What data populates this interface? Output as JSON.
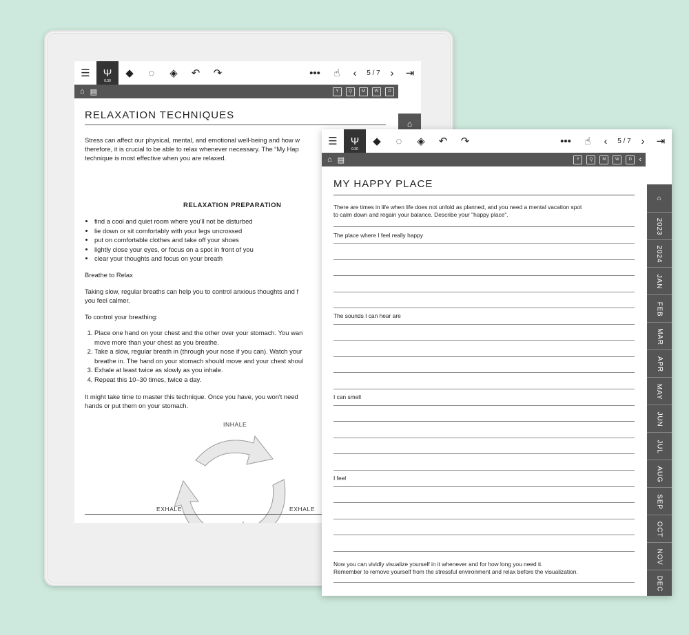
{
  "page1": {
    "toolbar": {
      "pen_size": "0.30",
      "page_indicator": "5 / 7"
    },
    "nav_boxes": [
      "Y",
      "Q",
      "M",
      "W",
      "D"
    ],
    "title": "RELAXATION TECHNIQUES",
    "intro_lines": [
      "Stress can affect our physical, mental, and emotional well-being and how w",
      "therefore, it is crucial to be able to relax whenever necessary. The “My Hap",
      "technique is most effective when you are relaxed."
    ],
    "prep_heading": "RELAXATION PREPARATION",
    "prep_items": [
      "find a cool and quiet room where you'll not be disturbed",
      "lie down or sit comfortably with your legs uncrossed",
      "put on comfortable clothes and take off your shoes",
      "lightly close your eyes, or focus on a spot in front of you",
      "clear your thoughts and focus on your breath"
    ],
    "breathe_heading": "Breathe to Relax",
    "breathe_lines": [
      "Taking slow, regular breaths can help you to control anxious thoughts and f",
      "you feel calmer."
    ],
    "control_heading": "To control your breathing:",
    "steps": [
      "Place one hand on your chest and the other over your stomach. You wan",
      "move more than your chest as you breathe.",
      "Take a slow, regular breath in (through your nose if you can). Watch your",
      "breathe in. The hand on your stomach should move and your chest shoul",
      "Exhale at least twice as slowly as you inhale.",
      "Repeat this 10–30 times, twice a day."
    ],
    "closing_lines": [
      "It might take time to master this technique. Once you have, you won't need",
      "hands or put them on your stomach."
    ],
    "cycle_labels": {
      "inhale": "INHALE",
      "exhale_left": "EXHALE",
      "exhale_right": "EXHALE"
    }
  },
  "page2": {
    "toolbar": {
      "pen_size": "0.30",
      "page_indicator": "5 / 7"
    },
    "nav_boxes": [
      "Y",
      "Q",
      "M",
      "W",
      "D"
    ],
    "title": "MY HAPPY PLACE",
    "intro_lines": [
      "There are times in life when life does not unfold as planned, and you need a mental vacation spot",
      "to calm down and regain your balance. Describe your \"happy place\"."
    ],
    "sections": [
      "The place where I feel really happy",
      "The sounds I can hear are",
      "I can smell",
      "I feel"
    ],
    "outro_lines": [
      "Now you can vividly visualize yourself in it whenever and for how long you need it.",
      "Remember to remove yourself from the stressful environment and relax before the visualization."
    ],
    "months": [
      "2023",
      "2024",
      "JAN",
      "FEB",
      "MAR",
      "APR",
      "MAY",
      "JUN",
      "JUL",
      "AUG",
      "SEP",
      "OCT",
      "NOV",
      "DEC"
    ]
  }
}
